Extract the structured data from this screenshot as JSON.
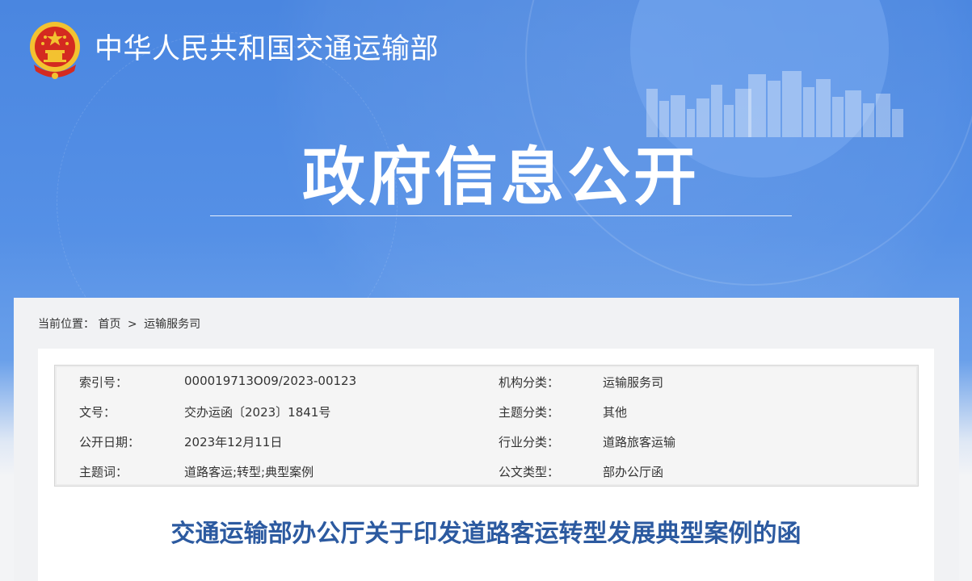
{
  "header": {
    "site_title": "中华人民共和国交通运输部",
    "section_title": "政府信息公开"
  },
  "breadcrumb": {
    "prefix": "当前位置：",
    "items": [
      "首页",
      "运输服务司"
    ],
    "separator": ">"
  },
  "metadata": [
    {
      "label": "索引号：",
      "value": "000019713O09/2023-00123",
      "label2": "机构分类：",
      "value2": "运输服务司"
    },
    {
      "label": "文号：",
      "value": "交办运函〔2023〕1841号",
      "label2": "主题分类：",
      "value2": "其他"
    },
    {
      "label": "公开日期：",
      "value": "2023年12月11日",
      "label2": "行业分类：",
      "value2": "道路旅客运输"
    },
    {
      "label": "主题词：",
      "value": "道路客运;转型;典型案例",
      "label2": "公文类型：",
      "value2": "部办公厅函"
    }
  ],
  "document": {
    "title": "交通运输部办公厅关于印发道路客运转型发展典型案例的函"
  },
  "colors": {
    "banner_blue": "#4a86e0",
    "title_blue": "#2c5aa0",
    "emblem_red": "#d42a20",
    "emblem_gold": "#f3c230"
  },
  "icons": {
    "emblem": "national-emblem-icon"
  }
}
